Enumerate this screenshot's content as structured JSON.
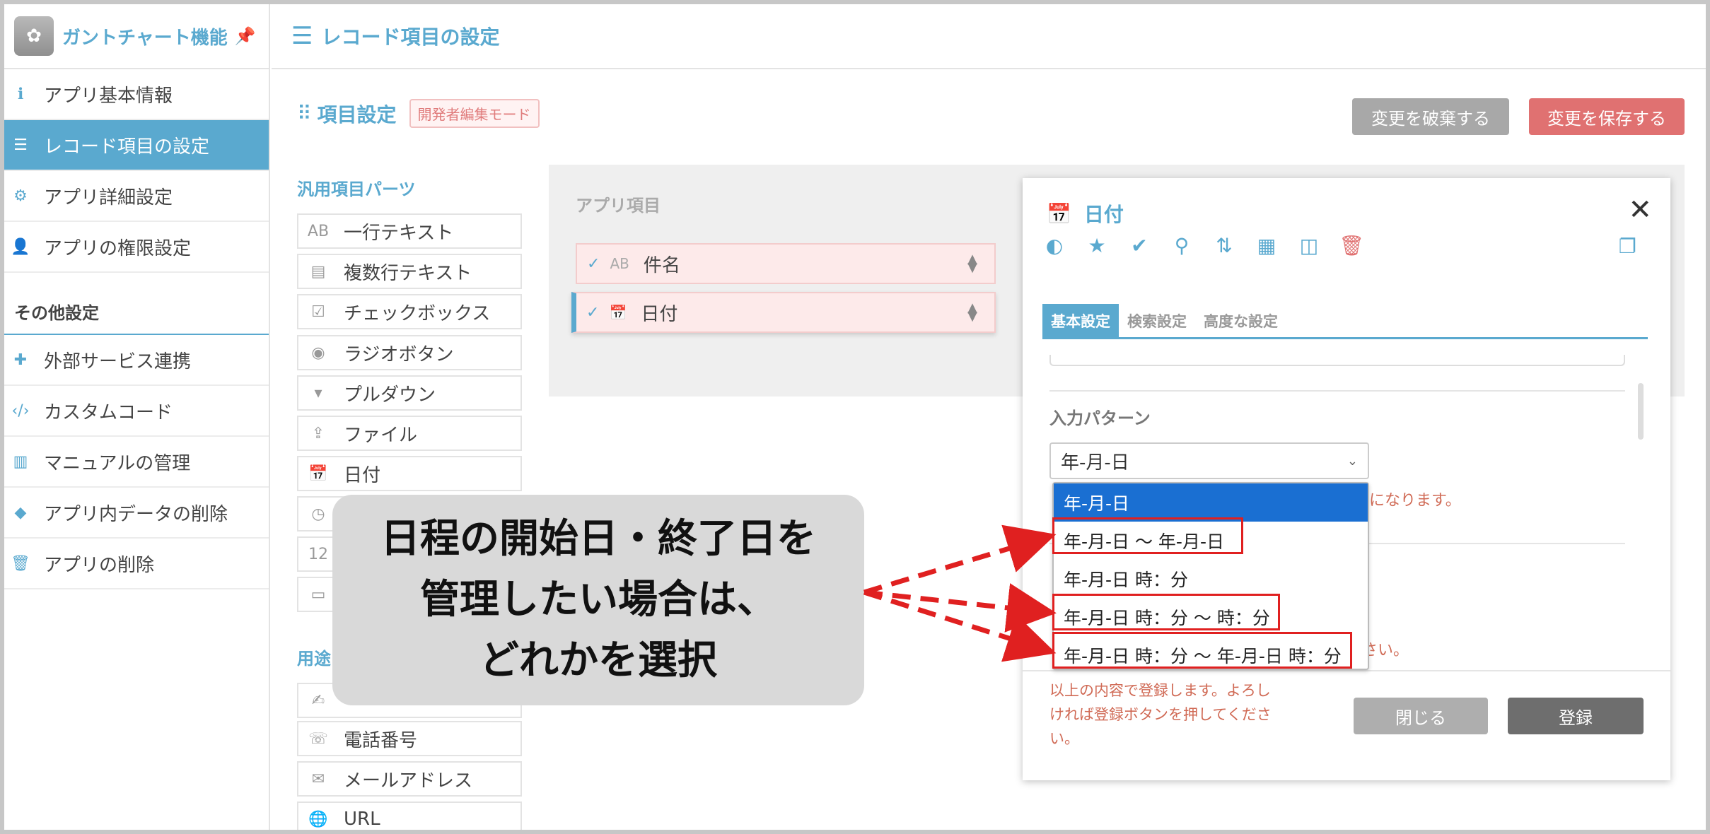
{
  "sidebar": {
    "app_title": "ガントチャート機能",
    "items": [
      {
        "label": "アプリ基本情報",
        "icon": "info-icon"
      },
      {
        "label": "レコード項目の設定",
        "icon": "list-icon"
      },
      {
        "label": "アプリ詳細設定",
        "icon": "gear-icon"
      },
      {
        "label": "アプリの権限設定",
        "icon": "user-lock-icon"
      }
    ],
    "section_title": "その他設定",
    "other_items": [
      {
        "label": "外部サービス連携",
        "icon": "puzzle-icon"
      },
      {
        "label": "カスタムコード",
        "icon": "code-icon"
      },
      {
        "label": "マニュアルの管理",
        "icon": "book-icon"
      },
      {
        "label": "アプリ内データの削除",
        "icon": "eraser-icon"
      },
      {
        "label": "アプリの削除",
        "icon": "trash-icon"
      }
    ]
  },
  "topbar": {
    "title": "レコード項目の設定"
  },
  "header": {
    "title": "項目設定",
    "badge": "開発者編集モード",
    "discard_label": "変更を破棄する",
    "save_label": "変更を保存する"
  },
  "parts": {
    "general_title": "汎用項目パーツ",
    "items": [
      "一行テキスト",
      "複数行テキスト",
      "チェックボックス",
      "ラジオボタン",
      "プルダウン",
      "ファイル",
      "日付"
    ],
    "usage_title": "用途",
    "usage_items": [
      "電話番号",
      "メールアドレス",
      "URL"
    ]
  },
  "app_items": {
    "title": "アプリ項目",
    "fields": [
      "件名",
      "日付"
    ]
  },
  "panel": {
    "title": "日付",
    "tabs": [
      "基本設定",
      "検索設定",
      "高度な設定"
    ],
    "pattern_label": "入力パターン",
    "selected_value": "年-月-日",
    "note1": "になります。",
    "note2": "さい。",
    "footer_message": "以上の内容で登録します。よろしければ登録ボタンを押してください。",
    "close_label": "閉じる",
    "register_label": "登録"
  },
  "dropdown": {
    "options": [
      "年-月-日",
      "年-月-日 ～ 年-月-日",
      "年-月-日 時：分",
      "年-月-日 時：分 ～ 時：分",
      "年-月-日 時：分 ～ 年-月-日 時：分"
    ],
    "highlighted_options": [
      1,
      3,
      4
    ]
  },
  "callout": {
    "lines": [
      "日程の開始日・終了日を",
      "管理したい場合は、",
      "どれかを選択"
    ]
  },
  "colors": {
    "accent": "#5aa9cf",
    "danger": "#e07171",
    "dropdown_selected": "#1a6fd2",
    "annotation_red": "#e02020"
  }
}
